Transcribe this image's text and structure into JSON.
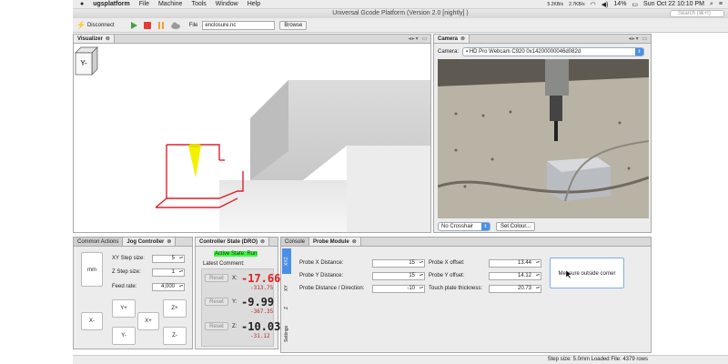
{
  "menubar": {
    "app": "ugsplatform",
    "items": [
      "File",
      "Machine",
      "Tools",
      "Window",
      "Help"
    ],
    "net_rates": [
      "5.2KB/s",
      "2.7KB/s"
    ],
    "battery": "14%",
    "datetime": "Sun Oct 22 10:10 PM"
  },
  "window": {
    "title": "Universal Gcode Platform (Version 2.0 [nightly]  )",
    "search_placeholder": "Search (⌘+I)"
  },
  "toolbar": {
    "disconnect_label": "Disconnect",
    "file_label": "File",
    "file_value": "enclosure.nc",
    "browse_label": "Browse"
  },
  "visualizer": {
    "tab": "Visualizer",
    "orientation_cube_label": "Y-"
  },
  "camera": {
    "tab": "Camera",
    "camera_label": "Camera:",
    "device": "HD Pro Webcam C920 0x14200000046d082d",
    "crosshair_option": "No Crosshair",
    "set_colour_label": "Set Colour..."
  },
  "jog": {
    "tabs": [
      "Common Actions",
      "Jog Controller"
    ],
    "units_button": "mm",
    "xy_step_label": "XY Step size:",
    "xy_step_value": "5",
    "z_step_label": "Z Step size:",
    "z_step_value": "1",
    "feed_label": "Feed rate:",
    "feed_value": "4,000",
    "buttons": {
      "y_plus": "Y+",
      "z_plus": "Z+",
      "x_minus": "X-",
      "x_plus": "X+",
      "y_minus": "Y-",
      "z_minus": "Z-"
    }
  },
  "dro": {
    "tab": "Controller State (DRO)",
    "active_state_label": "Active State:",
    "active_state_value": "Run",
    "latest_comment_label": "Latest Comment:",
    "reset_label": "Reset",
    "axes": [
      {
        "axis": "X:",
        "work": "-17.66",
        "machine": "-313.75"
      },
      {
        "axis": "Y:",
        "work": "-9.99",
        "machine": "-367.35"
      },
      {
        "axis": "Z:",
        "work": "-10.03",
        "machine": "-31.12"
      }
    ]
  },
  "probe": {
    "tabs": [
      "Console",
      "Probe Module"
    ],
    "side_tabs": [
      "XYZ",
      "XY",
      "Z",
      "Settings"
    ],
    "fields_left": [
      {
        "label": "Probe X Distance:",
        "value": "15"
      },
      {
        "label": "Probe Y Distance:",
        "value": "15"
      },
      {
        "label": "Probe Distance / Direction:",
        "value": "-10"
      }
    ],
    "fields_right": [
      {
        "label": "Probe X offset:",
        "value": "13.44"
      },
      {
        "label": "Probe Y offset:",
        "value": "14.12"
      },
      {
        "label": "Touch plate thickness:",
        "value": "20.73"
      }
    ],
    "measure_button": "Measure outside corner"
  },
  "status": {
    "text": "Step size: 5.0mm Loaded File: 4379 rows"
  },
  "colors": {
    "accent": "#4a8fe7",
    "active_state_bg": "#3cff3c",
    "dro_red": "#e02020",
    "probe_path": "#e0202a",
    "tool": "#f3f000"
  }
}
